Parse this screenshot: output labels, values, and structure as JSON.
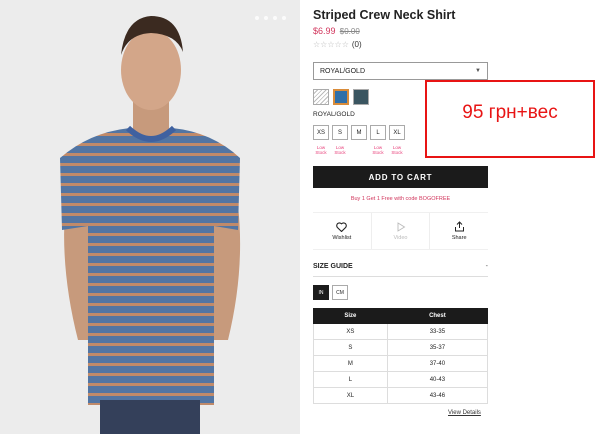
{
  "gallery": {
    "dot_count": 4,
    "active_index": 0
  },
  "product": {
    "title": "Striped Crew Neck Shirt",
    "price_sale": "$6.99",
    "price_original": "$0.00",
    "rating_stars": "☆☆☆☆☆",
    "review_count": "(0)",
    "selected_color": "ROYAL/GOLD",
    "color_label": "ROYAL/GOLD"
  },
  "swatches": [
    {
      "name": "white-striped",
      "selected": false
    },
    {
      "name": "royal-gold",
      "selected": true
    },
    {
      "name": "teal",
      "selected": false
    }
  ],
  "sizes": [
    {
      "label": "XS",
      "stock": "Low Stock"
    },
    {
      "label": "S",
      "stock": "Low Stock"
    },
    {
      "label": "M",
      "stock": ""
    },
    {
      "label": "L",
      "stock": "Low Stock"
    },
    {
      "label": "XL",
      "stock": "Low Stock"
    }
  ],
  "cart": {
    "label": "ADD TO CART"
  },
  "promo": "Buy 1 Get 1 Free with code BOGOFREE",
  "actions": {
    "wishlist": "Wishlist",
    "video": "Video",
    "share": "Share"
  },
  "size_guide": {
    "heading": "SIZE GUIDE",
    "toggle": "-",
    "units": [
      "IN",
      "CM"
    ],
    "active_unit": "IN",
    "columns": [
      "Size",
      "Chest"
    ],
    "rows": [
      [
        "XS",
        "33-35"
      ],
      [
        "S",
        "35-37"
      ],
      [
        "M",
        "37-40"
      ],
      [
        "L",
        "40-43"
      ],
      [
        "XL",
        "43-46"
      ]
    ],
    "view_details": "View Details"
  },
  "annotation": "95 грн+вес",
  "colors": {
    "accent": "#d1345b",
    "annotation": "#e81414",
    "button": "#1b1b1b"
  }
}
